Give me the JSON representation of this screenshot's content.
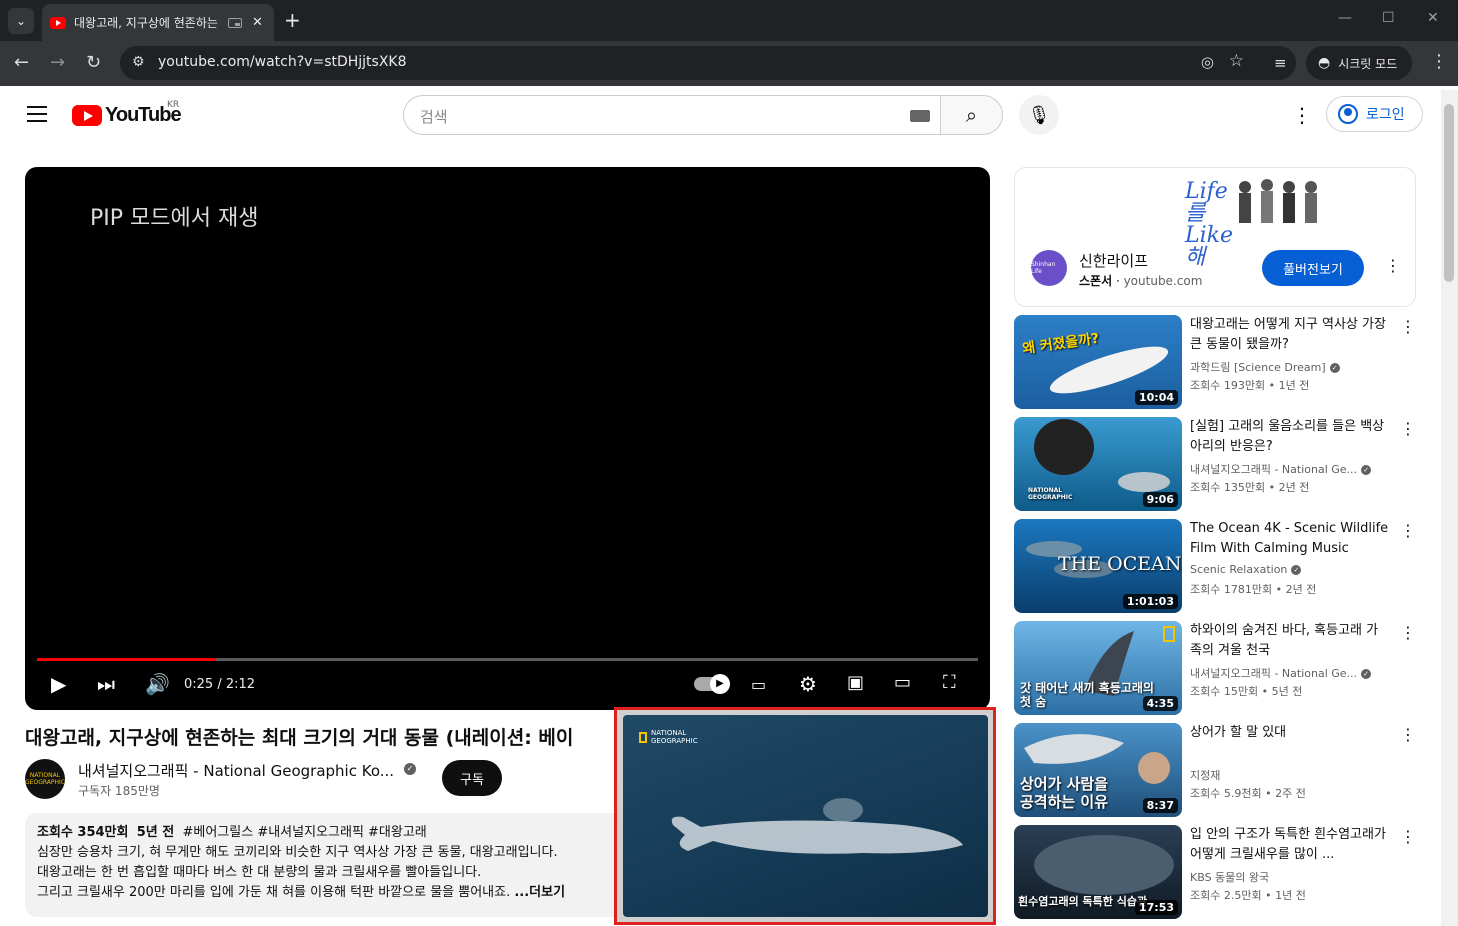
{
  "browser": {
    "tab_title": "대왕고래, 지구상에 현존하는 최대 크기의 거대 동물",
    "tab_close": "✕",
    "new_tab": "+",
    "url": "youtube.com/watch?v=stDHjjtsXK8",
    "incognito_label": "시크릿 모드"
  },
  "header": {
    "logo_text": "YouTube",
    "region": "KR",
    "search_placeholder": "검색",
    "signin_label": "로그인"
  },
  "player": {
    "pip_message": "PIP 모드에서 재생",
    "time": "0:25 / 2:12",
    "progress_fraction": 0.19
  },
  "video": {
    "title": "대왕고래, 지구상에 현존하는 최대 크기의 거대 동물 (내레이션: 베이",
    "channel": "내셔널지오그래픽 - National Geographic Ko...",
    "channel_avatar_text": "NATIONAL GEOGRAPHIC",
    "subscribers": "구독자 185만명",
    "subscribe_label": "구독",
    "views": "조회수 354만회",
    "age": "5년 전",
    "hashtags": "#베어그릴스 #내셔널지오그래픽 #대왕고래",
    "desc_line1": "심장만 승용차 크기, 혀 무게만 해도 코끼리와 비슷한 지구 역사상 가장 큰 동물, 대왕고래입니다.",
    "desc_line2": "대왕고래는 한 번 흡입할 때마다 버스 한 대 분량의 물과 크릴새우를 빨아들입니다.",
    "desc_line3": "그리고 크릴새우 200만 마리를 입에 가둔 채 혀를 이용해 턱판 바깥으로 물을 뿜어내죠.",
    "more_label": "...더보기"
  },
  "pip": {
    "logo_text": "NATIONAL GEOGRAPHIC"
  },
  "ad": {
    "banner_text": "Life를 Like해",
    "logo_text": "Shinhan Life",
    "title": "신한라이프",
    "sponsor_label": "스폰서",
    "domain": "youtube.com",
    "cta": "풀버전보기"
  },
  "related": [
    {
      "title": "대왕고래는 어떻게 지구 역사상 가장 큰 동물이 됐을까?",
      "channel": "과학드림 [Science Dream]",
      "verified": true,
      "views": "조회수 193만회",
      "age": "1년 전",
      "duration": "10:04",
      "thumb_text": "왜 커졌을까?"
    },
    {
      "title": "[실험] 고래의 울음소리를 들은 백상아리의 반응은?",
      "channel": "내셔널지오그래픽 - National Ge...",
      "verified": true,
      "views": "조회수 135만회",
      "age": "2년 전",
      "duration": "9:06",
      "thumb_text": "NATIONAL GEOGRAPHIC"
    },
    {
      "title": "The Ocean 4K - Scenic Wildlife Film With Calming Music",
      "channel": "Scenic Relaxation",
      "verified": true,
      "views": "조회수 1781만회",
      "age": "2년 전",
      "duration": "1:01:03",
      "thumb_text": "THE OCEAN"
    },
    {
      "title": "하와이의 숨겨진 바다, 혹등고래 가족의 겨울 천국",
      "channel": "내셔널지오그래픽 - National Ge...",
      "verified": true,
      "views": "조회수 15만회",
      "age": "5년 전",
      "duration": "4:35",
      "thumb_text": "갓 태어난 새끼 혹등고래의 첫 숨"
    },
    {
      "title": "상어가 할 말 있대",
      "channel": "지정재",
      "verified": false,
      "views": "조회수 5.9천회",
      "age": "2주 전",
      "duration": "8:37",
      "thumb_text": "상어가 사람을 공격하는 이유"
    },
    {
      "title": "입 안의 구조가 독특한 흰수염고래가 어떻게 크릴새우를 많이 ...",
      "channel": "KBS 동물의 왕국",
      "verified": false,
      "views": "조회수 2.5만회",
      "age": "1년 전",
      "duration": "17:53",
      "thumb_text": "흰수염고래의 독특한 식습관"
    }
  ]
}
